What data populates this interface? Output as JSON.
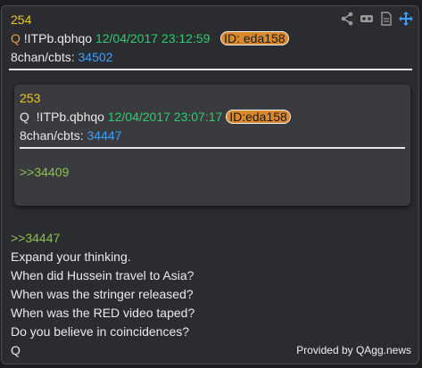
{
  "post": {
    "number": "254",
    "q_label": "Q",
    "tripcode": "!ITPb.qbhqo",
    "date": "12/04/2017 23:12:59",
    "id": "ID: eda158",
    "board_label": "8chan/cbts:",
    "board_link": "34502",
    "reply_ref": ">>34447",
    "lines": [
      "Expand your thinking.",
      "When did Hussein travel to Asia?",
      "When was the stringer released?",
      "When was the RED video taped?",
      "Do you believe in coincidences?",
      "Q"
    ]
  },
  "quoted": {
    "number": "253",
    "q_label": "Q",
    "tripcode": "!ITPb.qbhqo",
    "date": "12/04/2017 23:07:17",
    "id": "ID:eda158",
    "board_label": "8chan/cbts:",
    "board_link": "34447",
    "reply_ref": ">>34409"
  },
  "toolbar": {
    "icons": [
      "share-icon",
      "vr-icon",
      "document-icon",
      "move-icon"
    ]
  },
  "footer": {
    "credit": "Provided by QAgg.news"
  },
  "colors": {
    "number": "#f0c814",
    "date": "#2ecc71",
    "link": "#3ca0ff",
    "reply": "#8bc34a",
    "id_badge": "#d9892c"
  }
}
